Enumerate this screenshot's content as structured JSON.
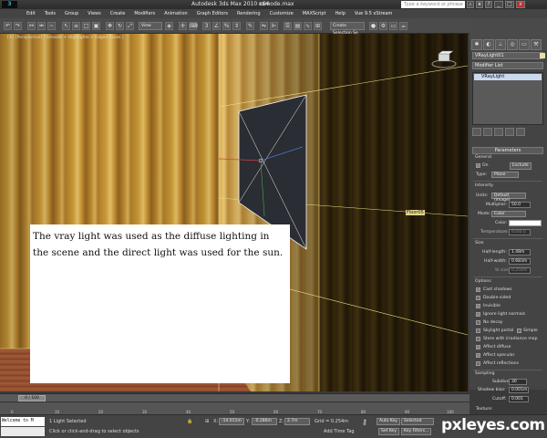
{
  "title_bar": {
    "logo": "3",
    "app_title": "Autodesk 3ds Max 2010 x64",
    "file_name": "csmode.max",
    "search_placeholder": "Type a keyword or phrase",
    "min": "_",
    "restore": "□",
    "close": "x"
  },
  "menu": [
    "Edit",
    "Tools",
    "Group",
    "Views",
    "Create",
    "Modifiers",
    "Animation",
    "Graph Editors",
    "Rendering",
    "Customize",
    "MAXScript",
    "Help",
    "Vue 9.5 xStream"
  ],
  "toolbar": {
    "view_dropdown": "View",
    "selection_set": "Create Selection Se"
  },
  "viewport": {
    "label": "[+] [Perspective] [ Smooth + Highlights + Edged Faces ]",
    "floor_label": "Floor05",
    "overlay_text": "The vray light was used as the diffuse lighting in the scene and the direct light was used for the sun."
  },
  "command_panel": {
    "object_name": "VRayLight01",
    "modifier_list": "Modifier List",
    "stack_item": "VRayLight",
    "parameters_title": "Parameters",
    "general": {
      "label": "General",
      "on": "On",
      "exclude": "Exclude",
      "type_label": "Type:",
      "type_value": "Plane"
    },
    "intensity": {
      "label": "Intensity",
      "units_label": "Units:",
      "units_value": "Default (image)",
      "multiplier_label": "Multiplier:",
      "multiplier_value": "50.0",
      "mode_label": "Mode:",
      "mode_value": "Color",
      "color_label": "Color:",
      "temperature_label": "Temperature:",
      "temperature_value": "6500.0"
    },
    "size": {
      "label": "Size",
      "half_length_label": "Half-length:",
      "half_length_value": "1.48m",
      "half_width_label": "Half-width:",
      "half_width_value": "0.683m",
      "w_size_label": "W size",
      "w_size_value": "0.254m"
    },
    "options": {
      "label": "Options",
      "items": [
        {
          "label": "Cast shadows",
          "checked": true
        },
        {
          "label": "Double-sided",
          "checked": false
        },
        {
          "label": "Invisible",
          "checked": true
        },
        {
          "label": "Ignore light normals",
          "checked": true
        },
        {
          "label": "No decay",
          "checked": false
        },
        {
          "label": "Skylight portal",
          "checked": false
        },
        {
          "label": "Store with irradiance map",
          "checked": false
        },
        {
          "label": "Affect diffuse",
          "checked": true
        },
        {
          "label": "Affect specular",
          "checked": true
        },
        {
          "label": "Affect reflections",
          "checked": false
        }
      ],
      "simple_label": "Simple"
    },
    "sampling": {
      "label": "Sampling",
      "subdivs_label": "Subdivs:",
      "subdivs_value": "30",
      "shadow_bias_label": "Shadow bias:",
      "shadow_bias_value": "0.001m",
      "cutoff_label": "Cutoff:",
      "cutoff_value": "0.001"
    },
    "texture_label": "Texture:"
  },
  "timeline": {
    "frame": "0 / 100",
    "ticks": [
      "0",
      "10",
      "20",
      "30",
      "40",
      "50",
      "60",
      "70",
      "80",
      "90",
      "100"
    ]
  },
  "status": {
    "maxscript": "Welcome to M",
    "selected": "1 Light Selected",
    "prompt": "Click or click-and-drag to select objects",
    "x_label": "X:",
    "x_value": "-14.011m",
    "y_label": "Y:",
    "y_value": "-0.286m",
    "z_label": "Z:",
    "z_value": "2.7m",
    "grid": "Grid = 0.254m",
    "add_time_tag": "Add Time Tag",
    "auto_key": "Auto Key",
    "selected_btn": "Selected",
    "set_key": "Set Key",
    "key_filters": "Key Filters..."
  },
  "watermark": "pxleyes.com",
  "colors": {
    "panel_bg": "#444444",
    "stack_highlight": "#c9d9ee",
    "light_color": "#ffffff"
  }
}
